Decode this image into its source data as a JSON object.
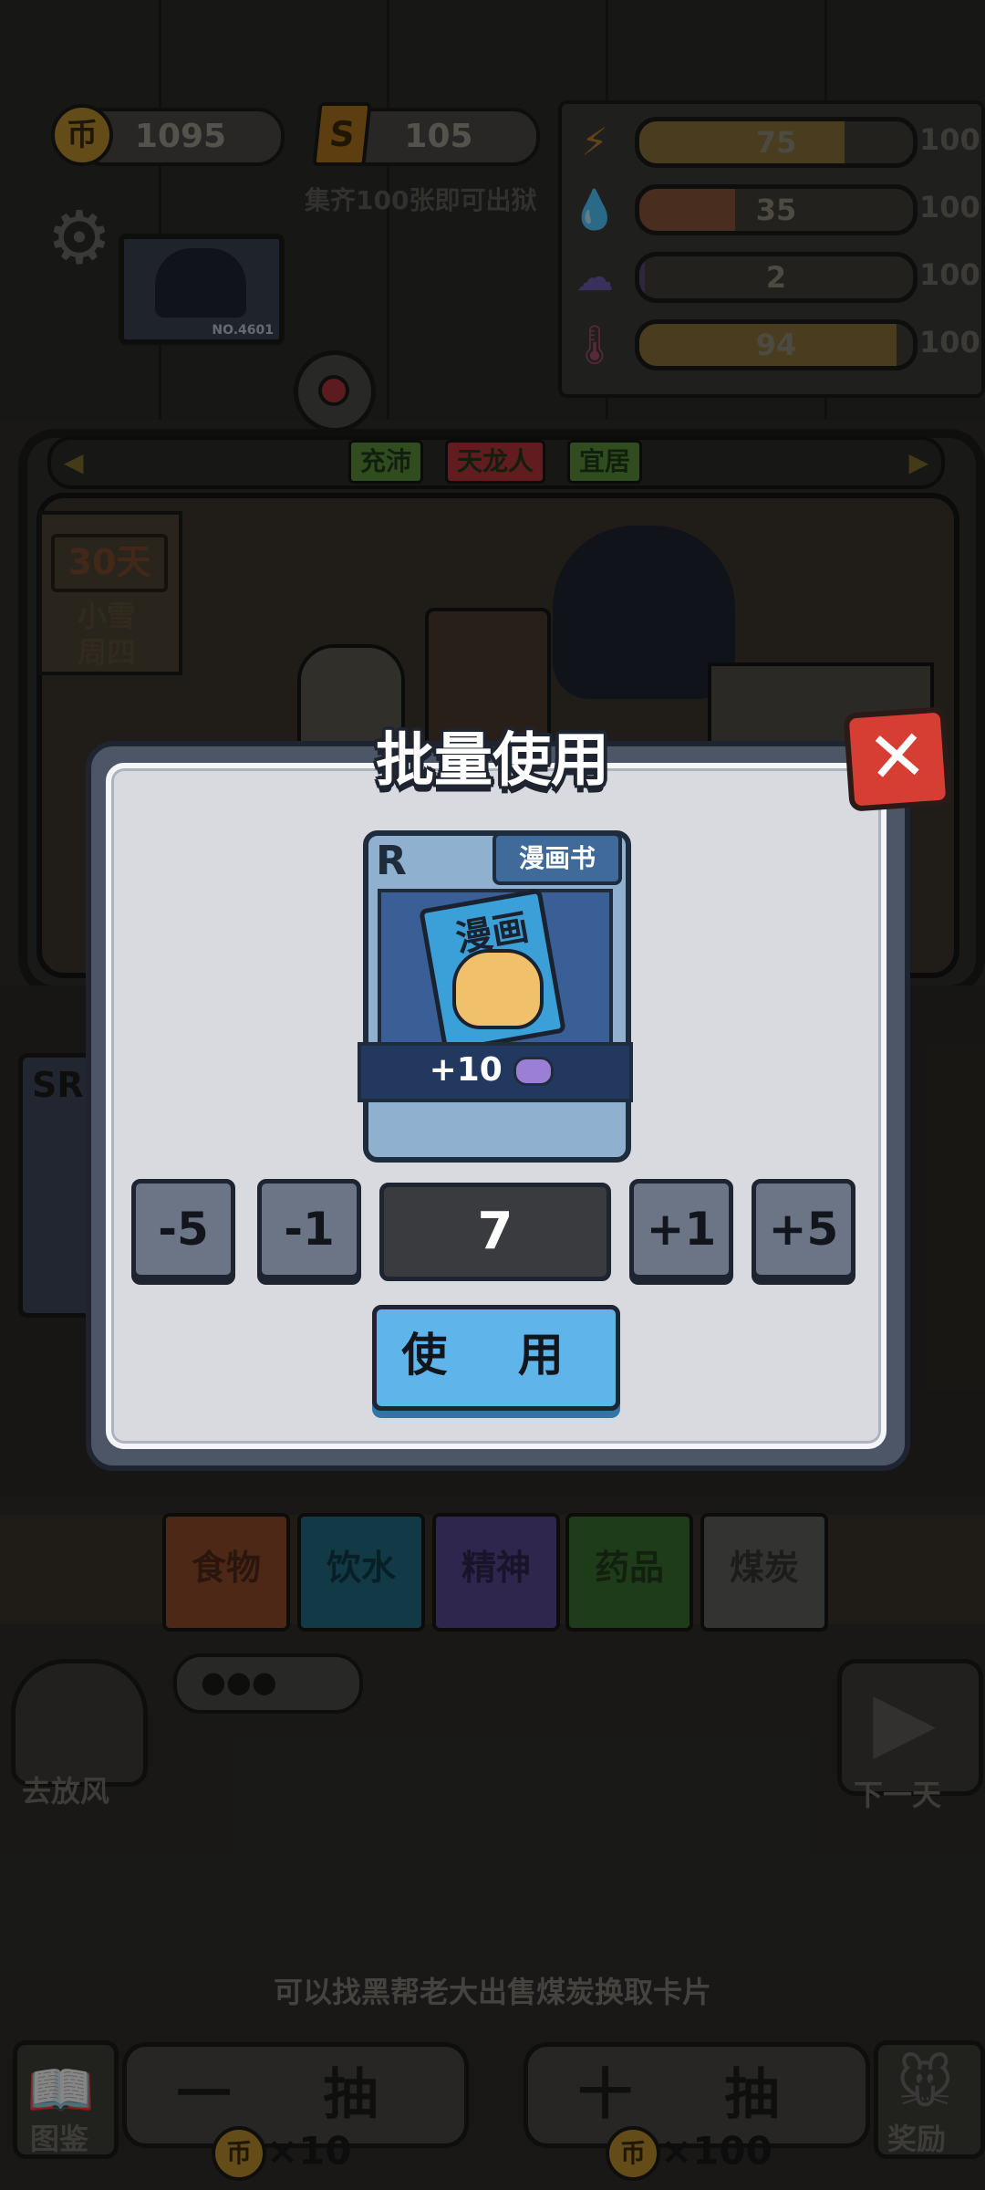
{
  "resources": {
    "coin_icon": "币",
    "coins": "1095",
    "ticket_icon": "S",
    "tickets": "105",
    "collect_hint": "集齐100张即可出狱"
  },
  "stats": [
    {
      "name": "energy",
      "icon": "lightning-icon",
      "glyph": "⚡",
      "value": "75",
      "max": "100",
      "level": 0.75,
      "color": "#c59a3c"
    },
    {
      "name": "water",
      "icon": "water-drop-icon",
      "glyph": "💧",
      "value": "35",
      "max": "100",
      "level": 0.35,
      "color": "#c0653a"
    },
    {
      "name": "mind",
      "icon": "brain-icon",
      "glyph": "☁",
      "value": "2",
      "max": "100",
      "level": 0.02,
      "color": "#6a4fa0"
    },
    {
      "name": "temperature",
      "icon": "thermometer-icon",
      "glyph": "🌡",
      "value": "94",
      "max": "100",
      "level": 0.94,
      "color": "#c59a3c"
    }
  ],
  "monitor_label": "NO.4601",
  "tags": [
    {
      "label": "充沛",
      "color": "#5a8a3a"
    },
    {
      "label": "天龙人",
      "color": "#b0343a"
    },
    {
      "label": "宜居",
      "color": "#5a8a3a"
    }
  ],
  "calendar": {
    "day": "30天",
    "weather": "小雪",
    "weekday": "周四"
  },
  "side_card_rarity": "SR",
  "categories": [
    {
      "label": "食物",
      "color": "#8e4a2a"
    },
    {
      "label": "饮水",
      "color": "#1f6a80"
    },
    {
      "label": "精神",
      "color": "#54468a"
    },
    {
      "label": "药品",
      "color": "#3a6e30"
    },
    {
      "label": "煤炭",
      "color": "#5e5e5c"
    }
  ],
  "actions": {
    "go_out": "去放风",
    "next_day": "下一天"
  },
  "bottom_hint": "可以找黑帮老大出售煤炭换取卡片",
  "draw": {
    "single_label": "一 抽",
    "single_cost": "×10",
    "ten_label": "十 抽",
    "ten_cost": "×100",
    "coin_icon": "币"
  },
  "nav": {
    "book": "图鉴",
    "reward": "奖励"
  },
  "dialog": {
    "title": "批量使用",
    "close_glyph": "✕",
    "card": {
      "rarity": "R",
      "name": "漫画书",
      "art_text": "漫画",
      "effect": "+10",
      "effect_icon": "brain-icon"
    },
    "steps": [
      "-5",
      "-1",
      "+1",
      "+5"
    ],
    "quantity": "7",
    "use_label": "使 用"
  }
}
